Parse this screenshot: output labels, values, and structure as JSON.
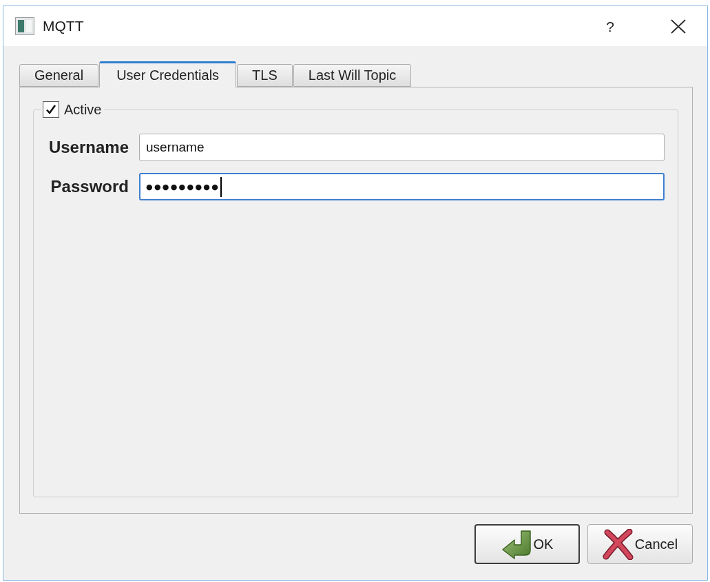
{
  "window": {
    "title": "MQTT",
    "help_button": "?"
  },
  "tabs": [
    {
      "label": "General",
      "selected": false
    },
    {
      "label": "User Credentials",
      "selected": true
    },
    {
      "label": "TLS",
      "selected": false
    },
    {
      "label": "Last Will Topic",
      "selected": false
    }
  ],
  "group": {
    "title": "Active",
    "checked": true
  },
  "fields": [
    {
      "kind": "text",
      "label": "Username",
      "value": "username",
      "focused": false
    },
    {
      "kind": "password",
      "label": "Password",
      "value": "●●●●●●●●●",
      "focused": true
    }
  ],
  "buttons": [
    {
      "label": "OK",
      "default": true
    },
    {
      "label": "Cancel",
      "default": false
    }
  ]
}
